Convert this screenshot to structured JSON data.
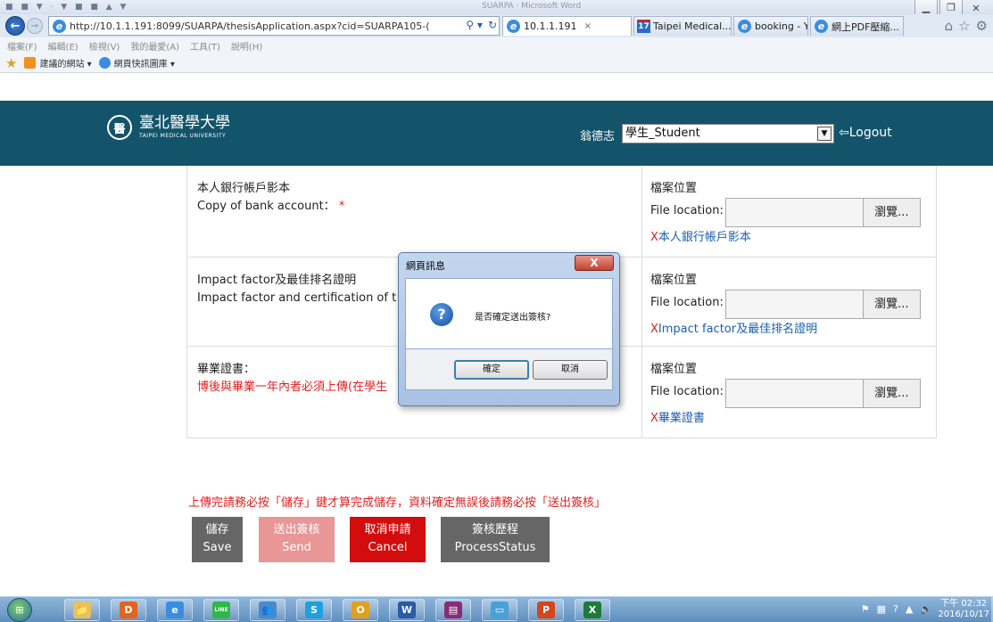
{
  "browser": {
    "title_left": "■ ■ ▼ · ▼ ■ ■ ▲ ▼",
    "title_blur": "SUARPA · Microsoft Word",
    "url": "http://10.1.1.191:8099/SUARPA/thesisApplication.aspx?cid=SUARPA105-(",
    "tabs": [
      {
        "label": "10.1.1.191",
        "close": "×"
      },
      {
        "label": "Taipei Medical...",
        "badge": "17"
      },
      {
        "label": "booking - Yah..."
      },
      {
        "label": "網上PDF壓縮..."
      }
    ],
    "menu": [
      "檔案(F)",
      "編輯(E)",
      "檢視(V)",
      "我的最愛(A)",
      "工具(T)",
      "說明(H)"
    ],
    "favorites": [
      "建議的網站 ▾",
      "網頁快訊圖庫 ▾"
    ]
  },
  "header": {
    "logo_name": "臺北醫學大學",
    "logo_sub": "TAIPEI MEDICAL UNIVERSITY",
    "logo_seal": "醫",
    "user_name": "翁德志",
    "role_selected": "學生_Student",
    "logout_label": "Logout",
    "logout_glyph": "⇦"
  },
  "form": {
    "rows": [
      {
        "label_zh": "本人銀行帳戶影本",
        "label_en": "Copy of bank account：",
        "required_mark": "*",
        "loc_zh": "檔案位置",
        "loc_en": "File location:",
        "browse": "瀏覽...",
        "err_x": "X",
        "err_text": "本人銀行帳戶影本"
      },
      {
        "label_zh": "Impact factor及最佳排名證明",
        "label_en": "Impact factor and certification of t",
        "loc_zh": "檔案位置",
        "loc_en": "File location:",
        "browse": "瀏覽...",
        "err_x": "X",
        "err_text": "Impact factor及最佳排名證明"
      },
      {
        "label_zh": "畢業證書：",
        "label_note": "博後與畢業一年內者必須上傳(在學生",
        "loc_zh": "檔案位置",
        "loc_en": "File location:",
        "browse": "瀏覽...",
        "err_x": "X",
        "err_text": "畢業證書"
      }
    ]
  },
  "notice": "上傳完請務必按「儲存」鍵才算完成儲存，資料確定無誤後請務必按「送出簽核」",
  "actions": {
    "save": {
      "zh": "儲存",
      "en": "Save"
    },
    "send": {
      "zh": "送出簽核",
      "en": "Send"
    },
    "cancel": {
      "zh": "取消申請",
      "en": "Cancel"
    },
    "status": {
      "zh": "簽核歷程",
      "en": "ProcessStatus"
    }
  },
  "dialog": {
    "title": "網頁訊息",
    "close": "X",
    "icon": "?",
    "message": "是否確定送出簽核?",
    "ok": "確定",
    "cancel": "取消"
  },
  "taskbar": {
    "start": "⊞",
    "apps": [
      {
        "name": "explorer",
        "glyph": "📁",
        "color": "#e8c15a"
      },
      {
        "name": "orange-app",
        "glyph": "D",
        "color": "#e3641f"
      },
      {
        "name": "ie",
        "glyph": "e",
        "color": "#3a8de0"
      },
      {
        "name": "line",
        "glyph": "LINE",
        "color": "#2fb84a"
      },
      {
        "name": "contacts",
        "glyph": "👥",
        "color": "#4a8ac8"
      },
      {
        "name": "skype",
        "glyph": "S",
        "color": "#1ea0e0"
      },
      {
        "name": "outlook",
        "glyph": "O",
        "color": "#e0a020"
      },
      {
        "name": "word",
        "glyph": "W",
        "color": "#2a5ba6"
      },
      {
        "name": "winrar",
        "glyph": "▤",
        "color": "#8a2a7a"
      },
      {
        "name": "remote",
        "glyph": "▭",
        "color": "#4aa0d8"
      },
      {
        "name": "powerpoint",
        "glyph": "P",
        "color": "#d2471d"
      },
      {
        "name": "excel",
        "glyph": "X",
        "color": "#1f7a3a"
      }
    ],
    "time": "下午 02:32",
    "date": "2016/10/17"
  }
}
